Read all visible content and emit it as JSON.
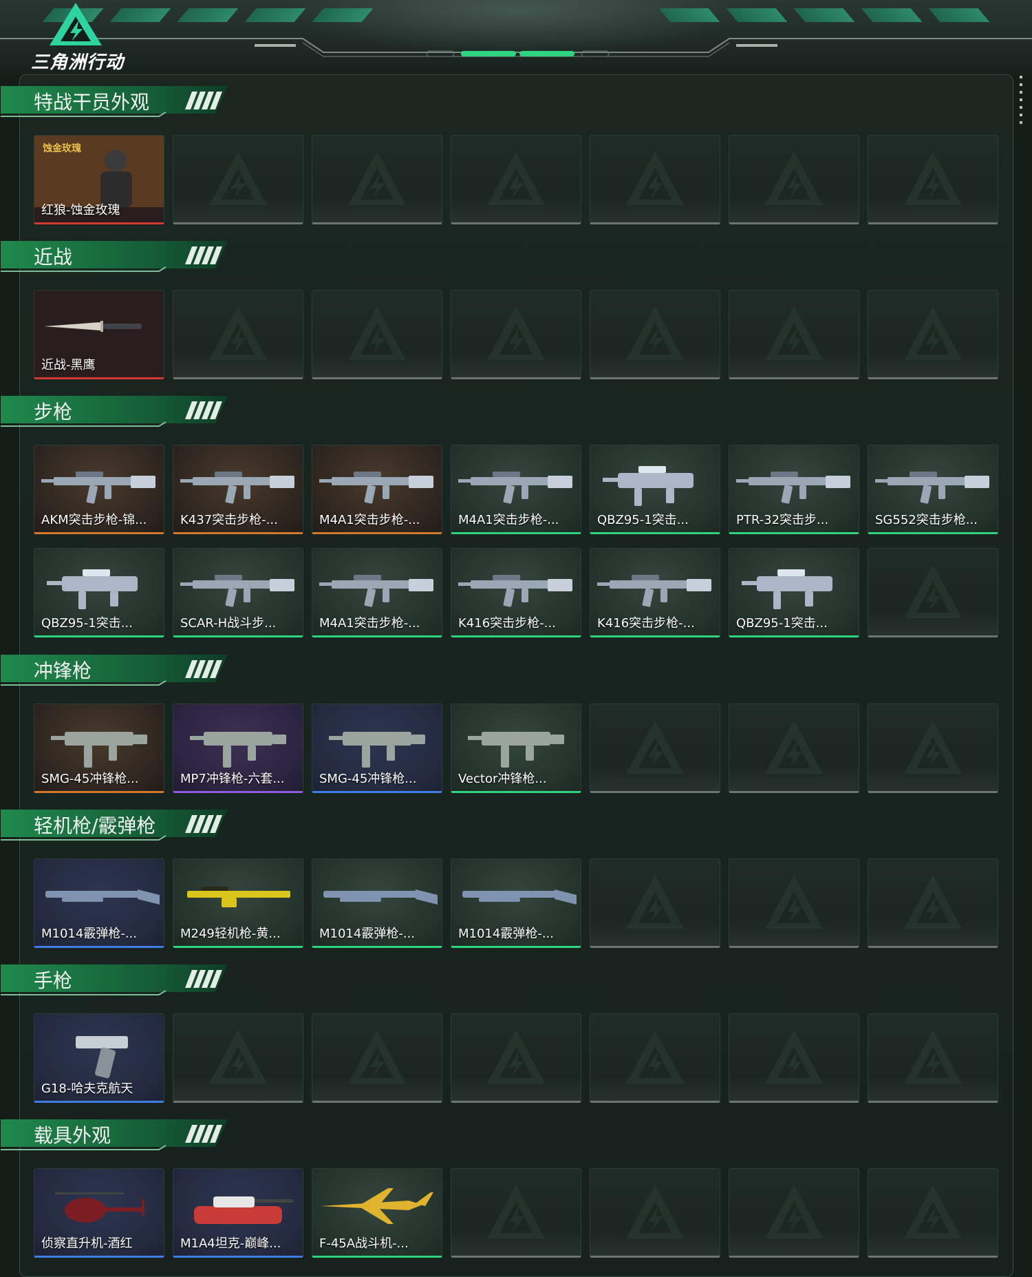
{
  "app": {
    "title": "三角洲行动"
  },
  "colors": {
    "accent": "#2ed47f",
    "quality_gold": "#d4782c",
    "quality_purple": "#8f5ce0",
    "quality_blue": "#3f7de8",
    "quality_red": "#d33a33",
    "empty": "#6d7570"
  },
  "sections": [
    {
      "title": "特战干员外观",
      "items": [
        {
          "label": "红狼-蚀金玫瑰",
          "quality": "red",
          "icon": "operator-portrait-icon",
          "caption": "蚀金玫瑰"
        }
      ]
    },
    {
      "title": "近战",
      "items": [
        {
          "label": "近战-黑鹰",
          "quality": "red",
          "icon": "knife-icon"
        }
      ]
    },
    {
      "title": "步枪",
      "items": [
        {
          "label": "AKM突击步枪-锦...",
          "quality": "gold",
          "icon": "rifle-icon"
        },
        {
          "label": "K437突击步枪-...",
          "quality": "gold",
          "icon": "rifle-icon"
        },
        {
          "label": "M4A1突击步枪-...",
          "quality": "gold",
          "icon": "rifle-icon"
        },
        {
          "label": "M4A1突击步枪-...",
          "quality": "green",
          "icon": "rifle-icon"
        },
        {
          "label": "QBZ95-1突击...",
          "quality": "green",
          "icon": "bullpup-rifle-icon"
        },
        {
          "label": "PTR-32突击步...",
          "quality": "green",
          "icon": "rifle-icon"
        },
        {
          "label": "SG552突击步枪...",
          "quality": "green",
          "icon": "rifle-icon"
        },
        {
          "label": "QBZ95-1突击...",
          "quality": "green",
          "icon": "bullpup-rifle-icon"
        },
        {
          "label": "SCAR-H战斗步...",
          "quality": "green",
          "icon": "rifle-icon"
        },
        {
          "label": "M4A1突击步枪-...",
          "quality": "green",
          "icon": "rifle-icon"
        },
        {
          "label": "K416突击步枪-...",
          "quality": "green",
          "icon": "rifle-icon"
        },
        {
          "label": "K416突击步枪-...",
          "quality": "green",
          "icon": "rifle-icon"
        },
        {
          "label": "QBZ95-1突击...",
          "quality": "green",
          "icon": "bullpup-rifle-icon"
        }
      ]
    },
    {
      "title": "冲锋枪",
      "items": [
        {
          "label": "SMG-45冲锋枪...",
          "quality": "gold",
          "icon": "smg-icon"
        },
        {
          "label": "MP7冲锋枪-六套...",
          "quality": "purple",
          "icon": "smg-icon"
        },
        {
          "label": "SMG-45冲锋枪...",
          "quality": "blue",
          "icon": "smg-icon"
        },
        {
          "label": "Vector冲锋枪...",
          "quality": "green",
          "icon": "smg-icon"
        }
      ]
    },
    {
      "title": "轻机枪/霰弹枪",
      "items": [
        {
          "label": "M1014霰弹枪-...",
          "quality": "blue",
          "icon": "shotgun-icon"
        },
        {
          "label": "M249轻机枪-黄...",
          "quality": "green",
          "icon": "lmg-icon"
        },
        {
          "label": "M1014霰弹枪-...",
          "quality": "green",
          "icon": "shotgun-icon"
        },
        {
          "label": "M1014霰弹枪-...",
          "quality": "green",
          "icon": "shotgun-icon"
        }
      ]
    },
    {
      "title": "手枪",
      "items": [
        {
          "label": "G18-哈夫克航天",
          "quality": "blue",
          "icon": "pistol-icon"
        }
      ]
    },
    {
      "title": "载具外观",
      "items": [
        {
          "label": "侦察直升机-酒红",
          "quality": "blue",
          "icon": "helicopter-icon"
        },
        {
          "label": "M1A4坦克-巅峰...",
          "quality": "blue",
          "icon": "tank-icon"
        },
        {
          "label": "F-45A战斗机-...",
          "quality": "green",
          "icon": "jet-icon"
        }
      ]
    }
  ]
}
